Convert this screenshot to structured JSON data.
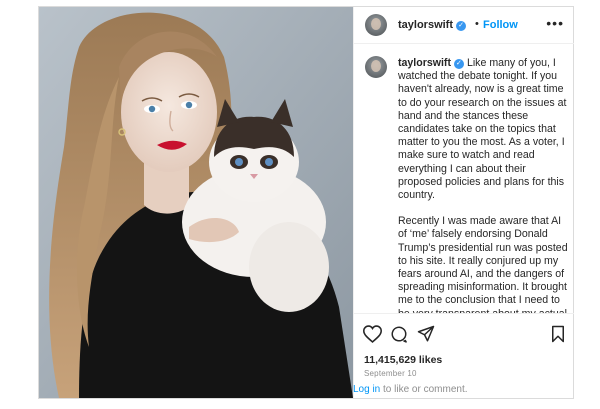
{
  "header": {
    "username": "taylorswift",
    "separator": "•",
    "follow_label": "Follow",
    "more_label": "•••"
  },
  "caption": {
    "username": "taylorswift",
    "paragraph1": "Like many of you, I watched the debate tonight. If you haven't already, now is a great time to do your research on the issues at hand and the stances these candidates take on the topics that matter to you the most. As a voter, I make sure to watch and read everything I can about their proposed policies and plans for this country.",
    "paragraph2": "Recently I was made aware that AI of ‘me’ falsely endorsing Donald Trump’s presidential run was posted to his site. It really conjured up my fears around AI, and the dangers of spreading misinformation. It brought me to the conclusion that I need to be very transparent about my actual plans for this election as a voter. The simplest way to combat"
  },
  "actions": {
    "icons": [
      "heart-icon",
      "comment-icon",
      "share-icon",
      "bookmark-icon"
    ],
    "likes": "11,415,629 likes",
    "date": "September 10",
    "login_link": "Log in",
    "login_text": " to like or comment."
  },
  "colors": {
    "accent": "#0095f6",
    "verified": "#3897f0",
    "text": "#262626",
    "muted": "#8e8e8e",
    "border": "#dbdbdb"
  }
}
